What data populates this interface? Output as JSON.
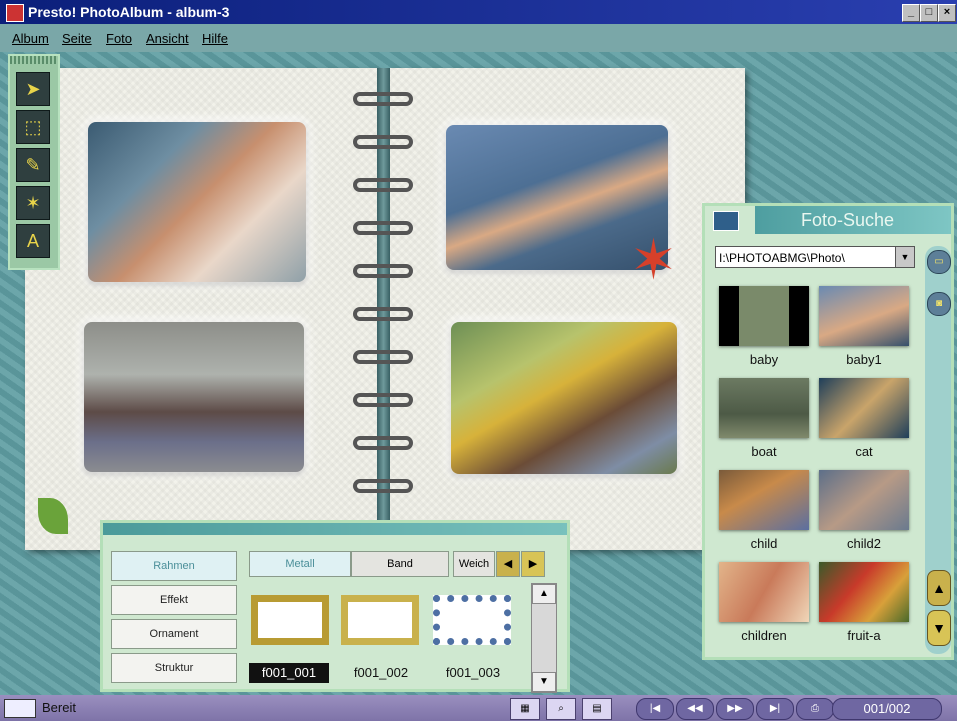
{
  "window": {
    "title": "Presto! PhotoAlbum - album-3",
    "min": "_",
    "max": "□",
    "close": "×"
  },
  "menu": [
    "Album",
    "Seite",
    "Foto",
    "Ansicht",
    "Hilfe"
  ],
  "tools": [
    {
      "icon": "pointer-arrow-icon",
      "glyph": "➤"
    },
    {
      "icon": "selection-rectangle-icon",
      "glyph": "⬚"
    },
    {
      "icon": "pencil-icon",
      "glyph": "✎"
    },
    {
      "icon": "node-edit-icon",
      "glyph": "✶"
    },
    {
      "icon": "text-tool-icon",
      "glyph": "A"
    }
  ],
  "palette": {
    "categories": [
      "Rahmen",
      "Effekt",
      "Ornament",
      "Struktur"
    ],
    "tabs": [
      "Metall",
      "Band",
      "Weich"
    ],
    "frames": [
      {
        "label": "f001_001",
        "color": "#b89b33"
      },
      {
        "label": "f001_002",
        "color": "#c9b14c"
      },
      {
        "label": "f001_003",
        "color": "#4d6fa3"
      }
    ],
    "nav_prev": "◀",
    "nav_next": "▶",
    "scroll_up": "▲",
    "scroll_down": "▼"
  },
  "suche": {
    "title": "Foto-Suche",
    "path": "I:\\PHOTOABMG\\Photo\\",
    "dropdown": "▼",
    "up": "▲",
    "down": "▼",
    "thumbs": [
      {
        "label": "baby"
      },
      {
        "label": "baby1"
      },
      {
        "label": "boat"
      },
      {
        "label": "cat"
      },
      {
        "label": "child"
      },
      {
        "label": "child2"
      },
      {
        "label": "children"
      },
      {
        "label": "fruit-a"
      }
    ]
  },
  "status": {
    "text": "Bereit",
    "page": "001/002"
  },
  "colors": {
    "accent": "#4e9ea0",
    "titlebar": "#0b1f7a",
    "statusbar": "#7e73a8"
  }
}
